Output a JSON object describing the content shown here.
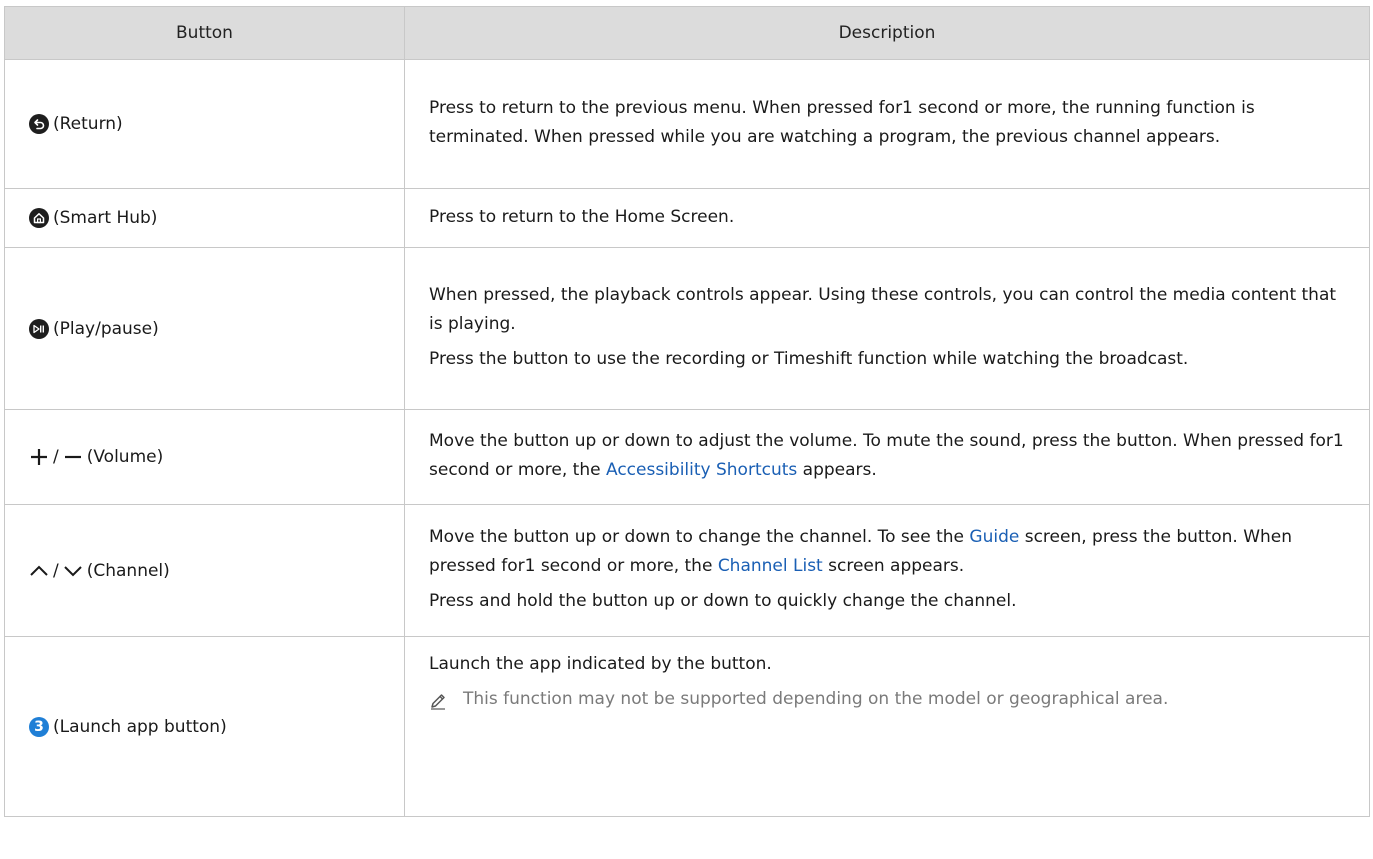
{
  "table": {
    "headers": {
      "button": "Button",
      "description": "Description"
    },
    "rows": [
      {
        "icon": "return-icon",
        "label": "(Return)",
        "paragraphs": [
          "Press to return to the previous menu. When pressed for1 second or more, the running function is terminated. When pressed while you are watching a program, the previous channel appears."
        ]
      },
      {
        "icon": "home-icon",
        "label": "(Smart Hub)",
        "paragraphs": [
          "Press to return to the Home Screen."
        ]
      },
      {
        "icon": "play-pause-icon",
        "label": "(Play/pause)",
        "paragraphs": [
          "When pressed, the playback controls appear. Using these controls, you can control the media content that is playing.",
          "Press the button to use the recording or Timeshift function while watching the broadcast."
        ]
      },
      {
        "icon": "volume-plus-minus-icon",
        "label": "(Volume)",
        "slash": "/",
        "p1_before": "Move the button up or down to adjust the volume. To mute the sound, press the button. When pressed for1 second or more, the ",
        "p1_link": "Accessibility Shortcuts",
        "p1_after": " appears."
      },
      {
        "icon": "channel-up-down-icon",
        "label": "(Channel)",
        "slash": "/",
        "p1_a": "Move the button up or down to change the channel. To see the ",
        "p1_link1": "Guide",
        "p1_b": " screen, press the button. When pressed for1 second or more, the ",
        "p1_link2": "Channel List",
        "p1_c": " screen appears.",
        "p2": "Press and hold the button up or down to quickly change the channel."
      },
      {
        "icon": "number-3-icon",
        "icon_text": "3",
        "label": "(Launch app button)",
        "p1": "Launch the app indicated by the button.",
        "note_icon": "pencil-note-icon",
        "note": "This function may not be supported depending on the model or geographical area."
      }
    ]
  },
  "colors": {
    "header_bg": "#dcdcdc",
    "border": "#c8c8c8",
    "link": "#1a5fb4",
    "note_text": "#7a7a7a",
    "badge_blue": "#1f7fd6"
  }
}
